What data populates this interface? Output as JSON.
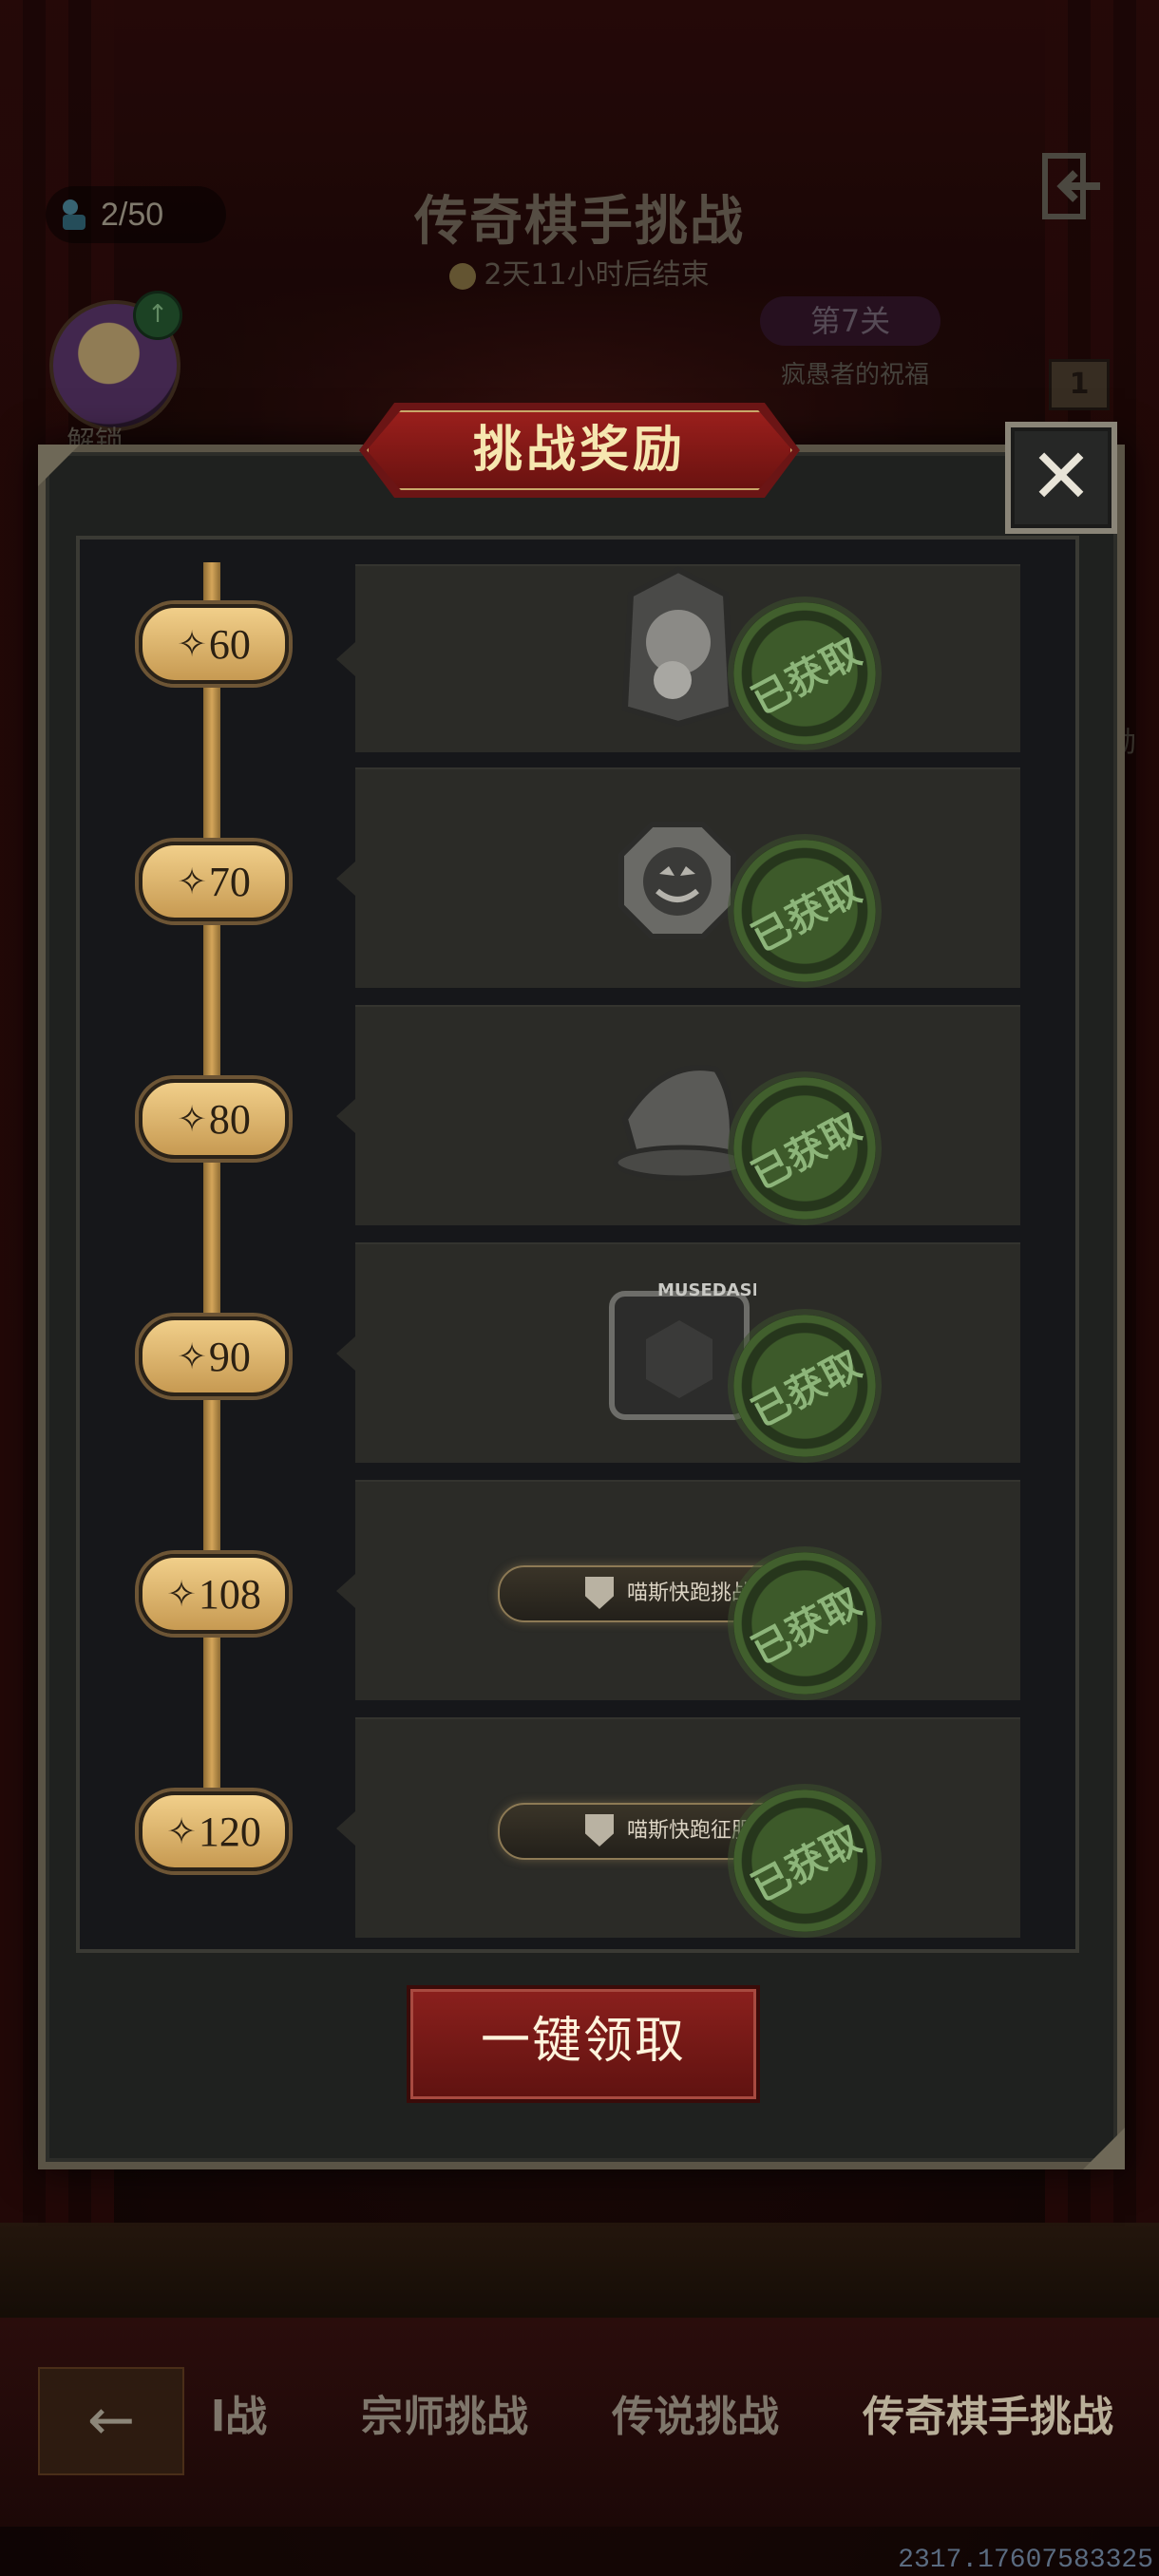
{
  "hud": {
    "count": "2/50",
    "event_title": "传奇棋手挑战",
    "timer": "2天11小时后结束",
    "avatar_label": "解锁",
    "stage_label": "第7关",
    "stage_subtitle": "疯愚者的祝福",
    "side_badge": "1",
    "side_text": "励"
  },
  "modal": {
    "title": "挑战奖励",
    "close_label": "✕",
    "claim_all_label": "一键领取"
  },
  "milestones": [
    {
      "value": "60"
    },
    {
      "value": "70"
    },
    {
      "value": "80"
    },
    {
      "value": "90"
    },
    {
      "value": "108"
    },
    {
      "value": "120"
    }
  ],
  "rewards": [
    {
      "icon": "character-card-icon",
      "status": "已获取"
    },
    {
      "icon": "pumpkin-badge-icon",
      "status": "已获取"
    },
    {
      "icon": "witch-hat-icon",
      "status": "已获取"
    },
    {
      "icon": "musedash-frame-icon",
      "frame_text": "MUSEDASH",
      "status": "已获取"
    },
    {
      "icon": "title-plate-icon",
      "title": "喵斯快跑挑战者",
      "status": "已获取"
    },
    {
      "icon": "title-plate-icon",
      "title": "喵斯快跑征服者",
      "status": "已获取"
    }
  ],
  "bottom_nav": {
    "back_label": "←",
    "tabs": [
      {
        "label": "l战"
      },
      {
        "label": "宗师挑战"
      },
      {
        "label": "传说挑战"
      },
      {
        "label": "传奇棋手挑战"
      }
    ]
  },
  "uid": "2317.17607583325"
}
